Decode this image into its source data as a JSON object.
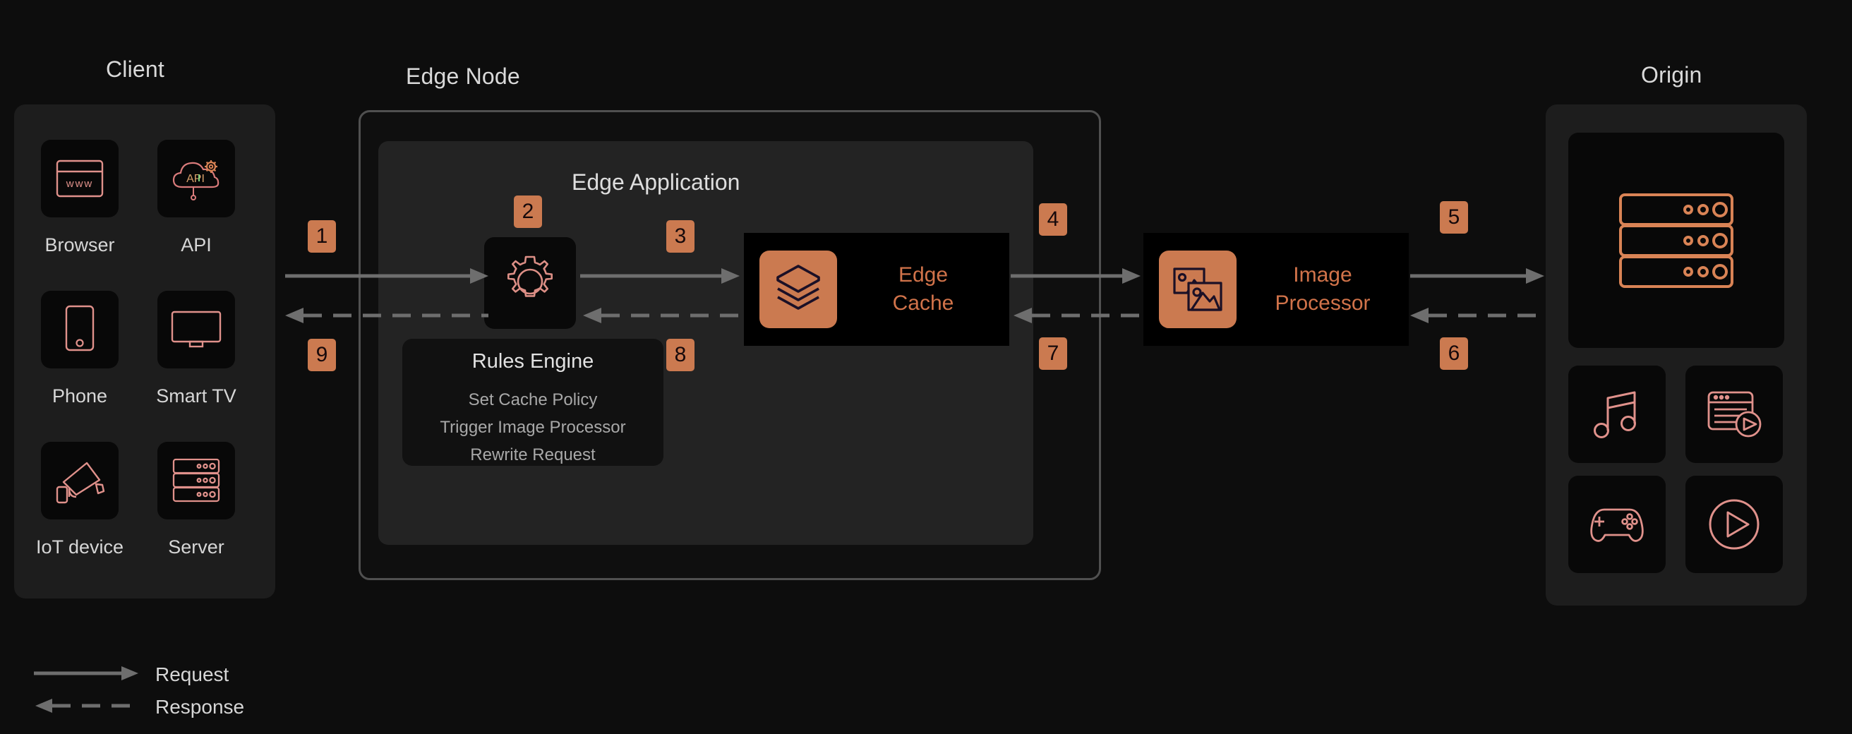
{
  "groups": {
    "client": {
      "title": "Client"
    },
    "edge_node": {
      "title": "Edge Node"
    },
    "origin": {
      "title": "Origin"
    }
  },
  "client_devices": [
    {
      "label": "Browser",
      "icon": "browser-www-icon"
    },
    {
      "label": "API",
      "icon": "api-cloud-gear-icon"
    },
    {
      "label": "Phone",
      "icon": "phone-icon"
    },
    {
      "label": "Smart TV",
      "icon": "smart-tv-icon"
    },
    {
      "label": "IoT device",
      "icon": "security-camera-icon"
    },
    {
      "label": "Server",
      "icon": "server-rack-icon"
    }
  ],
  "edge_application": {
    "title": "Edge Application",
    "rules_engine": {
      "icon": "gear-icon",
      "title": "Rules Engine",
      "items": [
        "Set Cache Policy",
        "Trigger Image Processor",
        "Rewrite Request"
      ]
    },
    "edge_cache": {
      "icon": "layers-stack-icon",
      "line1": "Edge",
      "line2": "Cache"
    }
  },
  "image_processor": {
    "icon": "images-photos-icon",
    "line1": "Image",
    "line2": "Processor"
  },
  "origin": {
    "main_icon": "server-rack-icon",
    "assets": [
      {
        "icon": "music-note-icon"
      },
      {
        "icon": "article-video-icon"
      },
      {
        "icon": "game-controller-icon"
      },
      {
        "icon": "play-circle-icon"
      }
    ]
  },
  "steps": [
    {
      "id": "1",
      "label": "1"
    },
    {
      "id": "2",
      "label": "2"
    },
    {
      "id": "3",
      "label": "3"
    },
    {
      "id": "4",
      "label": "4"
    },
    {
      "id": "5",
      "label": "5"
    },
    {
      "id": "6",
      "label": "6"
    },
    {
      "id": "7",
      "label": "7"
    },
    {
      "id": "8",
      "label": "8"
    },
    {
      "id": "9",
      "label": "9"
    }
  ],
  "legend": {
    "request": "Request",
    "response": "Response"
  },
  "colors": {
    "accent_orange": "#cb7a50",
    "accent_text": "#d1734a",
    "icon_pink": "#e0918b",
    "icon_orange": "#d98355",
    "arrow_gray": "#6e6e6e",
    "panel_bg": "#1d1d1d",
    "edge_app_bg": "#232323",
    "page_bg": "#0d0d0d",
    "tile_bg": "#080808",
    "text_primary": "#d8d8d8",
    "text_muted": "#a8a8a8"
  }
}
